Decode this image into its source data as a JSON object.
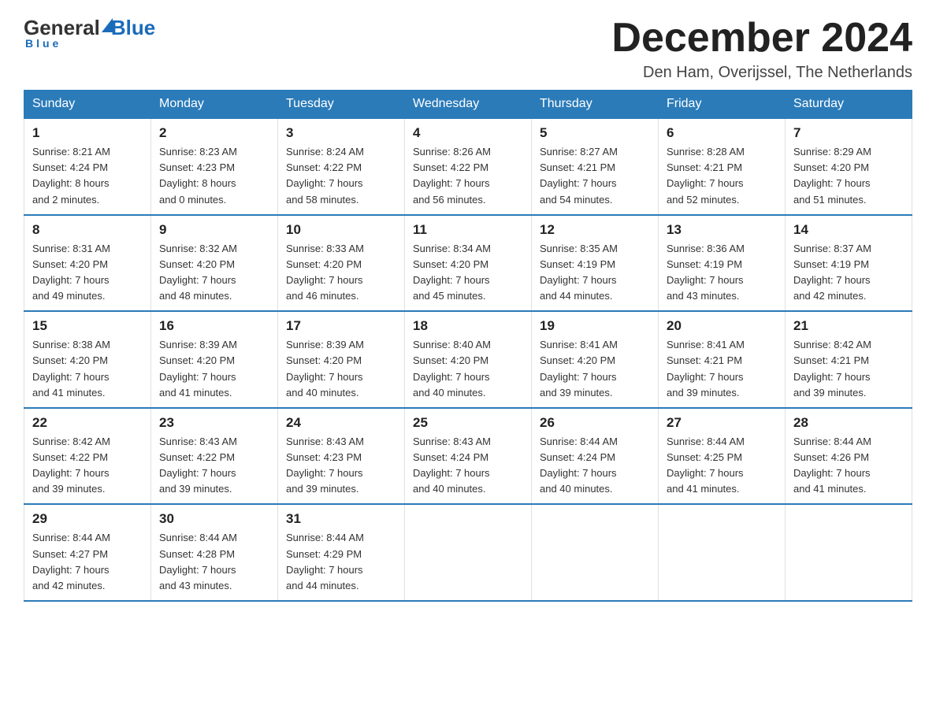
{
  "logo": {
    "general": "General",
    "blue": "Blue",
    "underline": "Blue"
  },
  "header": {
    "title": "December 2024",
    "location": "Den Ham, Overijssel, The Netherlands"
  },
  "weekdays": [
    "Sunday",
    "Monday",
    "Tuesday",
    "Wednesday",
    "Thursday",
    "Friday",
    "Saturday"
  ],
  "weeks": [
    [
      {
        "day": "1",
        "info": "Sunrise: 8:21 AM\nSunset: 4:24 PM\nDaylight: 8 hours\nand 2 minutes."
      },
      {
        "day": "2",
        "info": "Sunrise: 8:23 AM\nSunset: 4:23 PM\nDaylight: 8 hours\nand 0 minutes."
      },
      {
        "day": "3",
        "info": "Sunrise: 8:24 AM\nSunset: 4:22 PM\nDaylight: 7 hours\nand 58 minutes."
      },
      {
        "day": "4",
        "info": "Sunrise: 8:26 AM\nSunset: 4:22 PM\nDaylight: 7 hours\nand 56 minutes."
      },
      {
        "day": "5",
        "info": "Sunrise: 8:27 AM\nSunset: 4:21 PM\nDaylight: 7 hours\nand 54 minutes."
      },
      {
        "day": "6",
        "info": "Sunrise: 8:28 AM\nSunset: 4:21 PM\nDaylight: 7 hours\nand 52 minutes."
      },
      {
        "day": "7",
        "info": "Sunrise: 8:29 AM\nSunset: 4:20 PM\nDaylight: 7 hours\nand 51 minutes."
      }
    ],
    [
      {
        "day": "8",
        "info": "Sunrise: 8:31 AM\nSunset: 4:20 PM\nDaylight: 7 hours\nand 49 minutes."
      },
      {
        "day": "9",
        "info": "Sunrise: 8:32 AM\nSunset: 4:20 PM\nDaylight: 7 hours\nand 48 minutes."
      },
      {
        "day": "10",
        "info": "Sunrise: 8:33 AM\nSunset: 4:20 PM\nDaylight: 7 hours\nand 46 minutes."
      },
      {
        "day": "11",
        "info": "Sunrise: 8:34 AM\nSunset: 4:20 PM\nDaylight: 7 hours\nand 45 minutes."
      },
      {
        "day": "12",
        "info": "Sunrise: 8:35 AM\nSunset: 4:19 PM\nDaylight: 7 hours\nand 44 minutes."
      },
      {
        "day": "13",
        "info": "Sunrise: 8:36 AM\nSunset: 4:19 PM\nDaylight: 7 hours\nand 43 minutes."
      },
      {
        "day": "14",
        "info": "Sunrise: 8:37 AM\nSunset: 4:19 PM\nDaylight: 7 hours\nand 42 minutes."
      }
    ],
    [
      {
        "day": "15",
        "info": "Sunrise: 8:38 AM\nSunset: 4:20 PM\nDaylight: 7 hours\nand 41 minutes."
      },
      {
        "day": "16",
        "info": "Sunrise: 8:39 AM\nSunset: 4:20 PM\nDaylight: 7 hours\nand 41 minutes."
      },
      {
        "day": "17",
        "info": "Sunrise: 8:39 AM\nSunset: 4:20 PM\nDaylight: 7 hours\nand 40 minutes."
      },
      {
        "day": "18",
        "info": "Sunrise: 8:40 AM\nSunset: 4:20 PM\nDaylight: 7 hours\nand 40 minutes."
      },
      {
        "day": "19",
        "info": "Sunrise: 8:41 AM\nSunset: 4:20 PM\nDaylight: 7 hours\nand 39 minutes."
      },
      {
        "day": "20",
        "info": "Sunrise: 8:41 AM\nSunset: 4:21 PM\nDaylight: 7 hours\nand 39 minutes."
      },
      {
        "day": "21",
        "info": "Sunrise: 8:42 AM\nSunset: 4:21 PM\nDaylight: 7 hours\nand 39 minutes."
      }
    ],
    [
      {
        "day": "22",
        "info": "Sunrise: 8:42 AM\nSunset: 4:22 PM\nDaylight: 7 hours\nand 39 minutes."
      },
      {
        "day": "23",
        "info": "Sunrise: 8:43 AM\nSunset: 4:22 PM\nDaylight: 7 hours\nand 39 minutes."
      },
      {
        "day": "24",
        "info": "Sunrise: 8:43 AM\nSunset: 4:23 PM\nDaylight: 7 hours\nand 39 minutes."
      },
      {
        "day": "25",
        "info": "Sunrise: 8:43 AM\nSunset: 4:24 PM\nDaylight: 7 hours\nand 40 minutes."
      },
      {
        "day": "26",
        "info": "Sunrise: 8:44 AM\nSunset: 4:24 PM\nDaylight: 7 hours\nand 40 minutes."
      },
      {
        "day": "27",
        "info": "Sunrise: 8:44 AM\nSunset: 4:25 PM\nDaylight: 7 hours\nand 41 minutes."
      },
      {
        "day": "28",
        "info": "Sunrise: 8:44 AM\nSunset: 4:26 PM\nDaylight: 7 hours\nand 41 minutes."
      }
    ],
    [
      {
        "day": "29",
        "info": "Sunrise: 8:44 AM\nSunset: 4:27 PM\nDaylight: 7 hours\nand 42 minutes."
      },
      {
        "day": "30",
        "info": "Sunrise: 8:44 AM\nSunset: 4:28 PM\nDaylight: 7 hours\nand 43 minutes."
      },
      {
        "day": "31",
        "info": "Sunrise: 8:44 AM\nSunset: 4:29 PM\nDaylight: 7 hours\nand 44 minutes."
      },
      {
        "day": "",
        "info": ""
      },
      {
        "day": "",
        "info": ""
      },
      {
        "day": "",
        "info": ""
      },
      {
        "day": "",
        "info": ""
      }
    ]
  ]
}
